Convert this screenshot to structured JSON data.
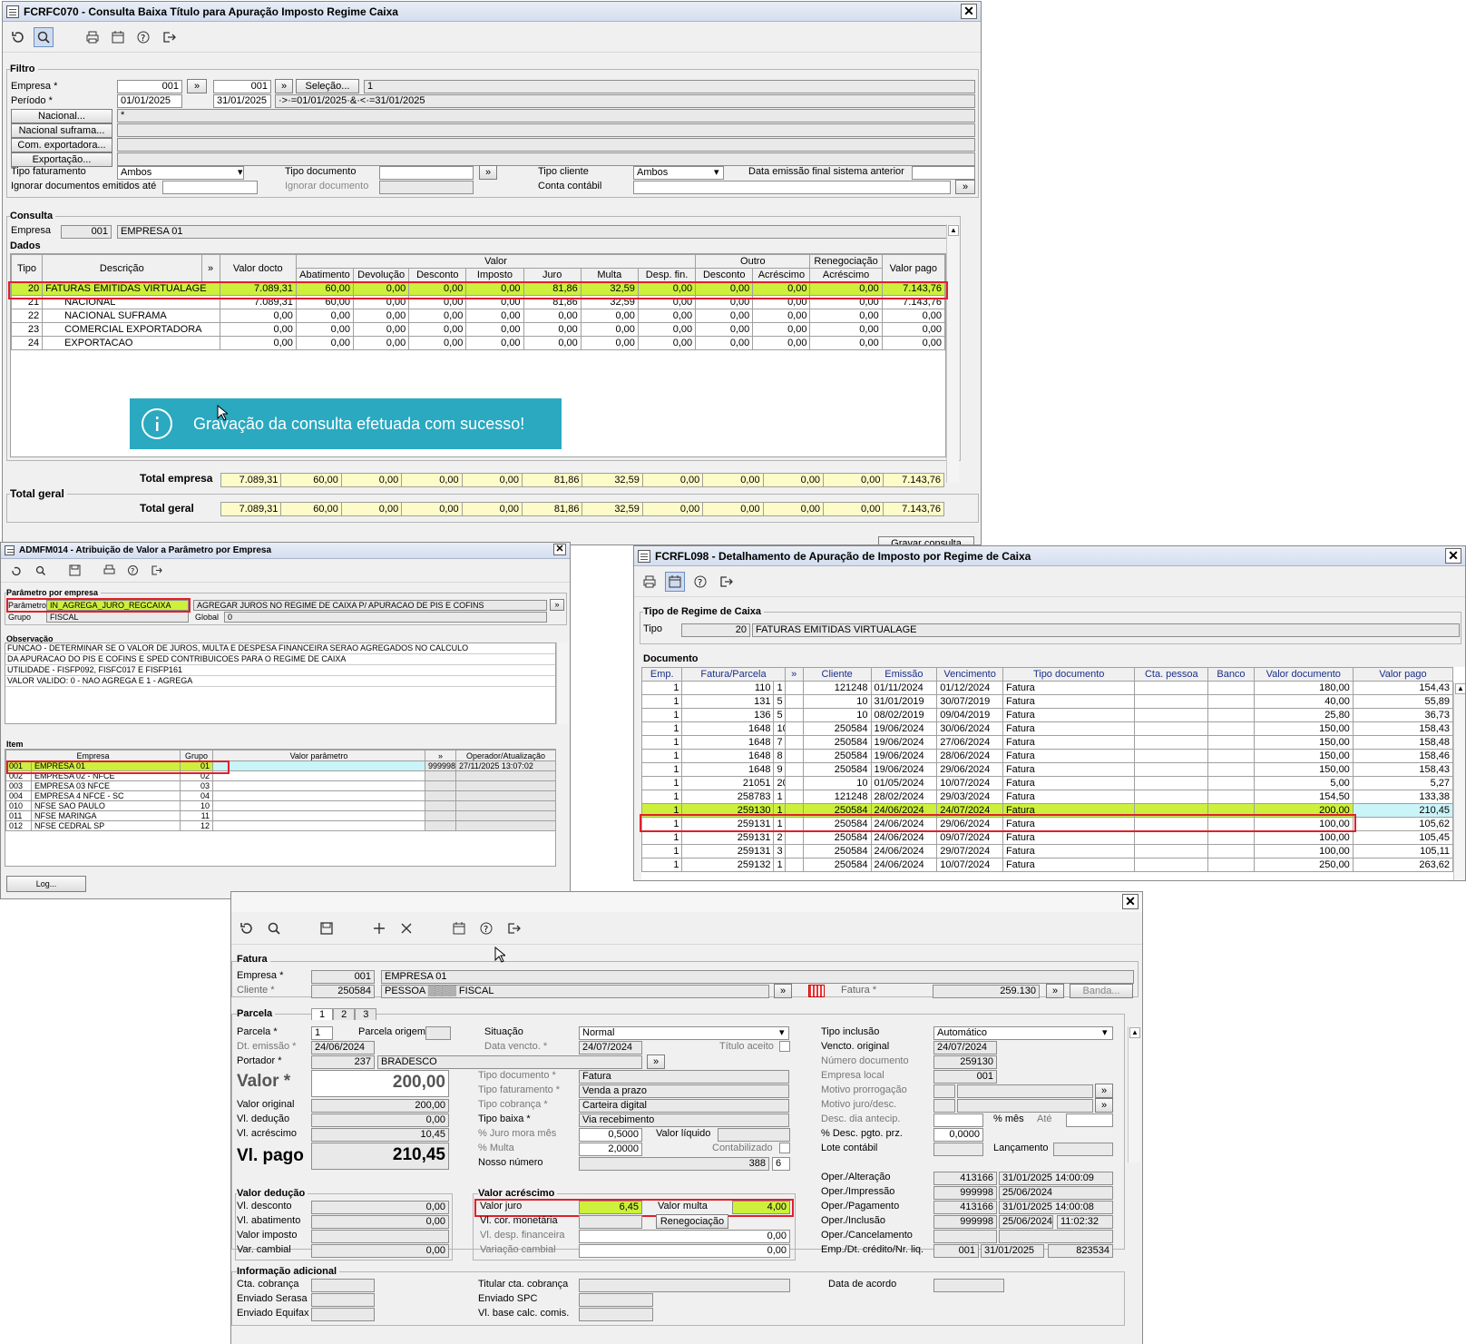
{
  "w1": {
    "title": "FCRFC070 - Consulta Baixa Título para Apuração Imposto Regime Caixa",
    "filtro": {
      "section": "Filtro",
      "empresa_label": "Empresa *",
      "empresa_ini": "001",
      "empresa_fim": "001",
      "selecao_btn": "Seleção...",
      "selecao_val": "1",
      "periodo_label": "Período *",
      "periodo_ini": "01/01/2025",
      "periodo_fim": "31/01/2025",
      "periodo_expr": "·>·=01/01/2025·&·<·=31/01/2025",
      "nacional_btn": "Nacional...",
      "nacional_val": "*",
      "suframa_btn": "Nacional suframa...",
      "comexp_btn": "Com. exportadora...",
      "exportacao_btn": "Exportação...",
      "tipo_fat_label": "Tipo faturamento",
      "tipo_fat_val": "Ambos",
      "tipo_doc_label": "Tipo documento",
      "tipo_cli_label": "Tipo cliente",
      "tipo_cli_val": "Ambos",
      "data_emissao_label": "Data emissão final sistema anterior",
      "ignorar_docs_label": "Ignorar documentos emitidos até",
      "ignorar_doc_label": "Ignorar documento",
      "conta_contabil_label": "Conta contábil"
    },
    "consulta": {
      "section": "Consulta",
      "empresa_label": "Empresa",
      "empresa_code": "001",
      "empresa_name": "EMPRESA 01",
      "dados": "Dados"
    },
    "headers": {
      "tipo": "Tipo",
      "descricao": "Descrição",
      "valor_docto": "Valor docto",
      "valor": "Valor",
      "outro": "Outro",
      "reneg": "Renegociação",
      "valor_pago": "Valor pago",
      "sub": [
        "Abatimento",
        "Devolução",
        "Desconto",
        "Imposto",
        "Juro",
        "Multa",
        "Desp. fin.",
        "Desconto",
        "Acréscimo",
        "Acréscimo"
      ]
    },
    "rows": [
      {
        "tipo": "20",
        "desc": "FATURAS EMITIDAS VIRTUALAGE",
        "vals": [
          "7.089,31",
          "60,00",
          "0,00",
          "0,00",
          "0,00",
          "81,86",
          "32,59",
          "0,00",
          "0,00",
          "0,00",
          "0,00",
          "7.143,76"
        ]
      },
      {
        "tipo": "21",
        "desc": "NACIONAL",
        "vals": [
          "7.089,31",
          "60,00",
          "0,00",
          "0,00",
          "0,00",
          "81,86",
          "32,59",
          "0,00",
          "0,00",
          "0,00",
          "0,00",
          "7.143,76"
        ]
      },
      {
        "tipo": "22",
        "desc": "NACIONAL SUFRAMA",
        "vals": [
          "0,00",
          "0,00",
          "0,00",
          "0,00",
          "0,00",
          "0,00",
          "0,00",
          "0,00",
          "0,00",
          "0,00",
          "0,00",
          "0,00"
        ]
      },
      {
        "tipo": "23",
        "desc": "COMERCIAL EXPORTADORA",
        "vals": [
          "0,00",
          "0,00",
          "0,00",
          "0,00",
          "0,00",
          "0,00",
          "0,00",
          "0,00",
          "0,00",
          "0,00",
          "0,00",
          "0,00"
        ]
      },
      {
        "tipo": "24",
        "desc": "EXPORTACAO",
        "vals": [
          "0,00",
          "0,00",
          "0,00",
          "0,00",
          "0,00",
          "0,00",
          "0,00",
          "0,00",
          "0,00",
          "0,00",
          "0,00",
          "0,00"
        ]
      }
    ],
    "toast": "Gravação da consulta efetuada com sucesso!",
    "total_empresa_label": "Total empresa",
    "total_geral_section": "Total geral",
    "total_geral_label": "Total geral",
    "totals": [
      "7.089,31",
      "60,00",
      "0,00",
      "0,00",
      "0,00",
      "81,86",
      "32,59",
      "0,00",
      "0,00",
      "0,00",
      "0,00",
      "7.143,76"
    ],
    "gravar_btn": "Gravar consulta"
  },
  "w2": {
    "title": "ADMFM014 - Atribuição de Valor a Parâmetro por Empresa",
    "param_section": "Parâmetro por empresa",
    "param_label": "Parâmetro",
    "param_val": "IN_AGREGA_JURO_REGCAIXA",
    "param_desc": "AGREGAR JUROS NO REGIME DE CAIXA P/ APURACAO DE PIS E COFINS",
    "grupo_label": "Grupo",
    "grupo_val": "FISCAL",
    "global_label": "Global",
    "global_val": "0",
    "obs_section": "Observação",
    "obs_lines": [
      "FUNCAO - DETERMINAR SE O VALOR DE JUROS, MULTA E DESPESA FINANCEIRA SERAO AGREGADOS NO CALCULO",
      "DA APURACAO DO PIS E COFINS E SPED CONTRIBUICOES PARA O REGIME DE CAIXA",
      "UTILIDADE - FISFP092, FISFC017 E FISFP161",
      "VALOR VALIDO: 0 - NAO AGREGA E 1 - AGREGA"
    ],
    "item_section": "Item",
    "headers": {
      "empresa": "Empresa",
      "grupo": "Grupo",
      "valor": "Valor parâmetro",
      "oper": "Operador/Atualização"
    },
    "items": [
      {
        "code": "001",
        "name": "EMPRESA 01",
        "grupo": "01",
        "valor": "",
        "op": "999998",
        "dt": "27/11/2025 13:07:02"
      },
      {
        "code": "002",
        "name": "EMPRESA 02 - NFCE",
        "grupo": "02",
        "valor": "",
        "op": "",
        "dt": ""
      },
      {
        "code": "003",
        "name": "EMPRESA 03 NFCE",
        "grupo": "03",
        "valor": "",
        "op": "",
        "dt": ""
      },
      {
        "code": "004",
        "name": "EMPRESA 4 NFCE - SC",
        "grupo": "04",
        "valor": "",
        "op": "",
        "dt": ""
      },
      {
        "code": "010",
        "name": "NFSE SAO PAULO",
        "grupo": "10",
        "valor": "",
        "op": "",
        "dt": ""
      },
      {
        "code": "011",
        "name": "NFSE MARINGA",
        "grupo": "11",
        "valor": "",
        "op": "",
        "dt": ""
      },
      {
        "code": "012",
        "name": "NFSE CEDRAL SP",
        "grupo": "12",
        "valor": "",
        "op": "",
        "dt": ""
      }
    ],
    "log_btn": "Log..."
  },
  "w3": {
    "title": "FCRFL098 - Detalhamento de Apuração de Imposto por Regime de Caixa",
    "tipo_section": "Tipo de Regime de Caixa",
    "tipo_label": "Tipo",
    "tipo_code": "20",
    "tipo_name": "FATURAS EMITIDAS VIRTUALAGE",
    "doc_section": "Documento",
    "headers": [
      "Emp.",
      "Fatura/Parcela",
      "»",
      "Cliente",
      "Emissão",
      "Vencimento",
      "Tipo documento",
      "Cta. pessoa",
      "Banco",
      "Valor documento",
      "Valor pago"
    ],
    "rows": [
      [
        "1",
        "110",
        "1",
        "121248",
        "01/11/2024",
        "01/12/2024",
        "Fatura",
        "180,00",
        "154,43"
      ],
      [
        "1",
        "131",
        "5",
        "10",
        "31/01/2019",
        "30/07/2019",
        "Fatura",
        "40,00",
        "55,89"
      ],
      [
        "1",
        "136",
        "5",
        "10",
        "08/02/2019",
        "09/04/2019",
        "Fatura",
        "25,80",
        "36,73"
      ],
      [
        "1",
        "1648",
        "10",
        "250584",
        "19/06/2024",
        "30/06/2024",
        "Fatura",
        "150,00",
        "158,43"
      ],
      [
        "1",
        "1648",
        "7",
        "250584",
        "19/06/2024",
        "27/06/2024",
        "Fatura",
        "150,00",
        "158,48"
      ],
      [
        "1",
        "1648",
        "8",
        "250584",
        "19/06/2024",
        "28/06/2024",
        "Fatura",
        "150,00",
        "158,46"
      ],
      [
        "1",
        "1648",
        "9",
        "250584",
        "19/06/2024",
        "29/06/2024",
        "Fatura",
        "150,00",
        "158,43"
      ],
      [
        "1",
        "21051",
        "20",
        "10",
        "01/05/2024",
        "10/07/2024",
        "Fatura",
        "5,00",
        "5,27"
      ],
      [
        "1",
        "258783",
        "1",
        "121248",
        "28/02/2024",
        "29/03/2024",
        "Fatura",
        "154,50",
        "133,38"
      ],
      [
        "1",
        "259130",
        "1",
        "250584",
        "24/06/2024",
        "24/07/2024",
        "Fatura",
        "200,00",
        "210,45"
      ],
      [
        "1",
        "259131",
        "1",
        "250584",
        "24/06/2024",
        "29/06/2024",
        "Fatura",
        "100,00",
        "105,62"
      ],
      [
        "1",
        "259131",
        "2",
        "250584",
        "24/06/2024",
        "09/07/2024",
        "Fatura",
        "100,00",
        "105,45"
      ],
      [
        "1",
        "259131",
        "3",
        "250584",
        "24/06/2024",
        "29/07/2024",
        "Fatura",
        "100,00",
        "105,11"
      ],
      [
        "1",
        "259132",
        "1",
        "250584",
        "24/06/2024",
        "10/07/2024",
        "Fatura",
        "250,00",
        "263,62"
      ]
    ]
  },
  "w4": {
    "fatura_section": "Fatura",
    "empresa_label": "Empresa *",
    "empresa_code": "001",
    "empresa_name": "EMPRESA 01",
    "cliente_label": "Cliente *",
    "cliente_code": "250584",
    "cliente_name": "PESSOA ▒▒▒▒ FISCAL",
    "fatura_label": "Fatura *",
    "fatura_val": "259.130",
    "banda_btn": "Banda...",
    "parcela_section": "Parcela",
    "tabs": [
      "1",
      "2",
      "3"
    ],
    "parcela_label": "Parcela *",
    "parcela_val": "1",
    "parcela_origem_label": "Parcela origem",
    "dt_emissao_label": "Dt. emissão *",
    "dt_emissao_val": "24/06/2024",
    "portador_label": "Portador *",
    "portador_code": "237",
    "portador_name": "BRADESCO",
    "valor_label": "Valor *",
    "valor_val": "200,00",
    "valor_original_label": "Valor original",
    "valor_original_val": "200,00",
    "vl_deducao_label": "Vl. dedução",
    "vl_deducao_val": "0,00",
    "vl_acrescimo_label": "Vl. acréscimo",
    "vl_acrescimo_val": "10,45",
    "vl_pago_label": "Vl. pago",
    "vl_pago_val": "210,45",
    "situacao_label": "Situação",
    "situacao_val": "Normal",
    "data_vencto_label": "Data vencto. *",
    "data_vencto_val": "24/07/2024",
    "titulo_aceito_label": "Título aceito",
    "tipo_doc_label": "Tipo documento *",
    "tipo_doc_val": "Fatura",
    "tipo_fat_label": "Tipo faturamento *",
    "tipo_fat_val": "Venda a prazo",
    "tipo_cob_label": "Tipo cobrança *",
    "tipo_cob_val": "Carteira digital",
    "tipo_baixa_label": "Tipo baixa *",
    "tipo_baixa_val": "Via recebimento",
    "juro_mora_label": "% Juro mora mês",
    "juro_mora_val": "0,5000",
    "valor_liquido_label": "Valor líquido",
    "multa_label": "% Multa",
    "multa_val": "2,0000",
    "contabilizado_label": "Contabilizado",
    "nosso_numero_label": "Nosso número",
    "nosso_numero_val": "388",
    "nosso_numero_dv": "6",
    "tipo_inclusao_label": "Tipo inclusão",
    "tipo_inclusao_val": "Automático",
    "vencto_original_label": "Vencto. original",
    "vencto_original_val": "24/07/2024",
    "numero_doc_label": "Número documento",
    "numero_doc_val": "259130",
    "empresa_local_label": "Empresa local",
    "empresa_local_val": "001",
    "motivo_prorrog_label": "Motivo prorrogação",
    "motivo_juro_label": "Motivo juro/desc.",
    "desc_dia_label": "Desc. dia antecip.",
    "pct_mes_label": "% mês",
    "ate_label": "Até",
    "pct_desc_label": "% Desc. pgto. prz.",
    "pct_desc_val": "0,0000",
    "lote_label": "Lote contábil",
    "lancamento_label": "Lançamento",
    "oper_alteracao_label": "Oper./Alteração",
    "oper_alteracao_op": "413166",
    "oper_alteracao_dt": "31/01/2025 14:00:09",
    "oper_impressao_label": "Oper./Impressão",
    "oper_impressao_op": "999998",
    "oper_impressao_dt": "25/06/2024",
    "oper_pagamento_label": "Oper./Pagamento",
    "oper_pagamento_op": "413166",
    "oper_pagamento_dt": "31/01/2025 14:00:08",
    "oper_inclusao_label": "Oper./Inclusão",
    "oper_inclusao_op": "999998",
    "oper_inclusao_dt": "25/06/2024",
    "oper_inclusao_hr": "11:02:32",
    "oper_cancel_label": "Oper./Cancelamento",
    "emp_dt_label": "Emp./Dt. crédito/Nr. liq.",
    "emp_dt_emp": "001",
    "emp_dt_dt": "31/01/2025",
    "emp_dt_nr": "823534",
    "deducao_section": "Valor dedução",
    "vl_desconto_label": "Vl. desconto",
    "vl_desconto_val": "0,00",
    "vl_abatimento_label": "Vl. abatimento",
    "vl_abatimento_val": "0,00",
    "valor_imposto_label": "Valor imposto",
    "var_cambial_label": "Var. cambial",
    "var_cambial_val": "0,00",
    "acrescimo_section": "Valor acréscimo",
    "valor_juro_label": "Valor juro",
    "valor_juro_val": "6,45",
    "valor_multa_label": "Valor multa",
    "valor_multa_val": "4,00",
    "vl_cor_label": "Vl. cor. monetária",
    "renegociacao_btn": "Renegociação",
    "vl_desp_label": "Vl. desp. financeira",
    "vl_desp_val": "0,00",
    "variacao_label": "Variação cambial",
    "variacao_val": "0,00",
    "info_section": "Informação adicional",
    "cta_cob_label": "Cta. cobrança",
    "titular_label": "Titular cta. cobrança",
    "data_acordo_label": "Data de acordo",
    "serasa_label": "Enviado Serasa",
    "spc_label": "Enviado SPC",
    "equifax_label": "Enviado Equifax",
    "base_calc_label": "Vl. base calc. comis."
  },
  "icons": {
    "refresh": "refresh-icon",
    "search": "search-icon",
    "print": "printer-icon",
    "calendar": "calendar-icon",
    "help": "help-icon",
    "exit": "exit-icon",
    "save": "save-icon",
    "add": "add-icon",
    "delete": "delete-icon",
    "info": "info-icon"
  },
  "colors": {
    "highlight": "#ccf03b",
    "toast": "#2aa9c0",
    "redbox": "#e0202a"
  }
}
